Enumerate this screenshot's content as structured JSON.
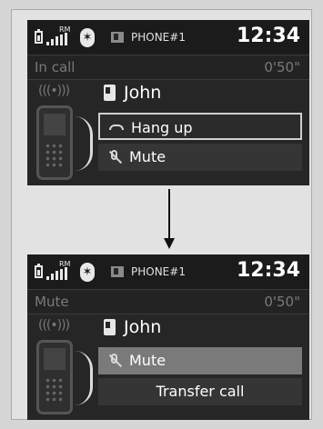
{
  "top_screen": {
    "status": {
      "rm_label": "RM",
      "bluetooth_icon": "bluetooth-icon",
      "phone_label": "PHONE#1",
      "clock": "12:34"
    },
    "state_label": "In call",
    "timer": "0'50\"",
    "contact_name": "John",
    "options": [
      {
        "label": "Hang up",
        "icon": "hang-up-icon"
      },
      {
        "label": "Mute",
        "icon": "mute-icon"
      }
    ]
  },
  "bottom_screen": {
    "status": {
      "rm_label": "RM",
      "bluetooth_icon": "bluetooth-icon",
      "phone_label": "PHONE#1",
      "clock": "12:34"
    },
    "state_label": "Mute",
    "timer": "0'50\"",
    "contact_name": "John",
    "options": [
      {
        "label": "Mute",
        "icon": "mute-icon"
      },
      {
        "label": "Transfer call",
        "icon": ""
      }
    ]
  },
  "transition_arrow_icon": "arrow-down-icon"
}
